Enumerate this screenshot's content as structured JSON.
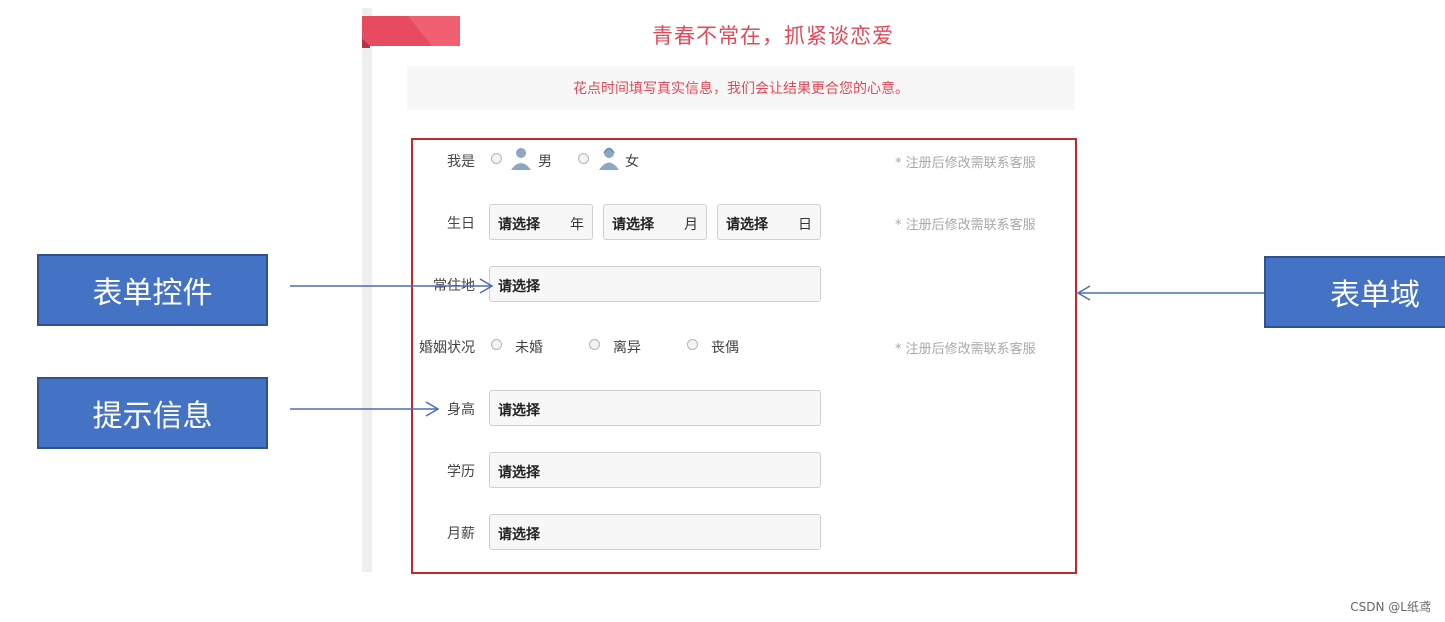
{
  "page": {
    "title": "青春不常在，抓紧谈恋爱",
    "subtitle": "花点时间填写真实信息，我们会让结果更合您的心意。",
    "accent_color": "#e04a59",
    "form_border_color": "#c0282d"
  },
  "form": {
    "gender": {
      "label": "我是",
      "male": "男",
      "female": "女",
      "male_icon": "male-user-icon",
      "female_icon": "female-user-icon",
      "hint": "* 注册后修改需联系客服"
    },
    "birthday": {
      "label": "生日",
      "year": "请选择",
      "year_unit": "年",
      "month": "请选择",
      "month_unit": "月",
      "day": "请选择",
      "day_unit": "日",
      "hint": "* 注册后修改需联系客服"
    },
    "residence": {
      "label": "常住地",
      "value": "请选择"
    },
    "marital": {
      "label": "婚姻状况",
      "opt1": "未婚",
      "opt2": "离异",
      "opt3": "丧偶",
      "hint": "* 注册后修改需联系客服"
    },
    "height": {
      "label": "身高",
      "value": "请选择"
    },
    "education": {
      "label": "学历",
      "value": "请选择"
    },
    "salary": {
      "label": "月薪",
      "value": "请选择"
    }
  },
  "annotations": {
    "form_control": "表单控件",
    "prompt_info": "提示信息",
    "form_domain": "表单域",
    "callout_color": "#4472c4",
    "arrow_color": "#4a6fb5"
  },
  "watermark": "CSDN @L纸鸢"
}
